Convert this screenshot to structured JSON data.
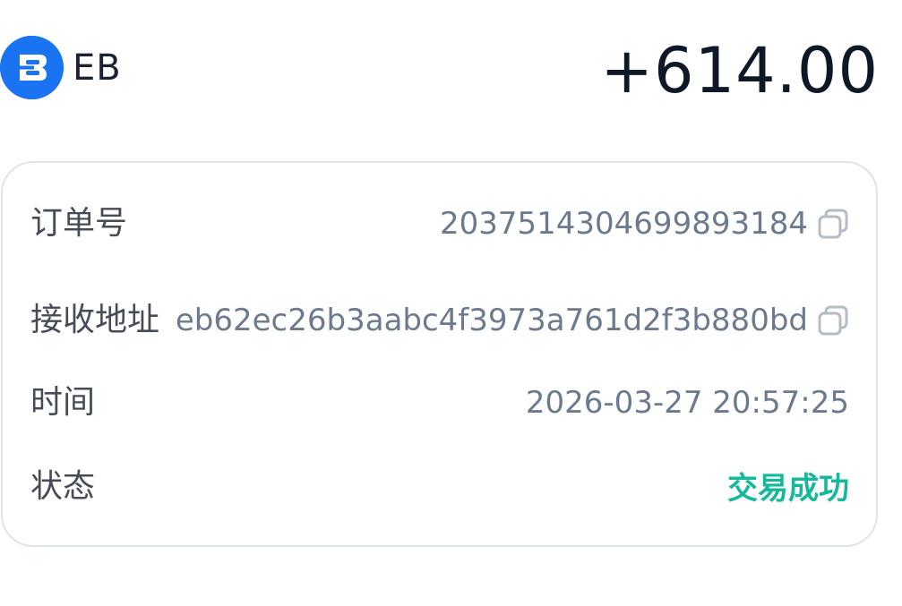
{
  "header": {
    "coin_symbol": "EB",
    "amount": "+614.00",
    "logo_icon": "eb-coin-logo-icon",
    "logo_color": "#1a73f0"
  },
  "details": {
    "order_label": "订单号",
    "order_value": "2037514304699893184",
    "address_label": "接收地址",
    "address_value": "eb62ec26b3aabc4f3973a761d2f3b880bd",
    "time_label": "时间",
    "time_value": "2026-03-27 20:57:25",
    "status_label": "状态",
    "status_value": "交易成功",
    "status_color": "#16b89a",
    "copy_icon": "copy-icon"
  }
}
